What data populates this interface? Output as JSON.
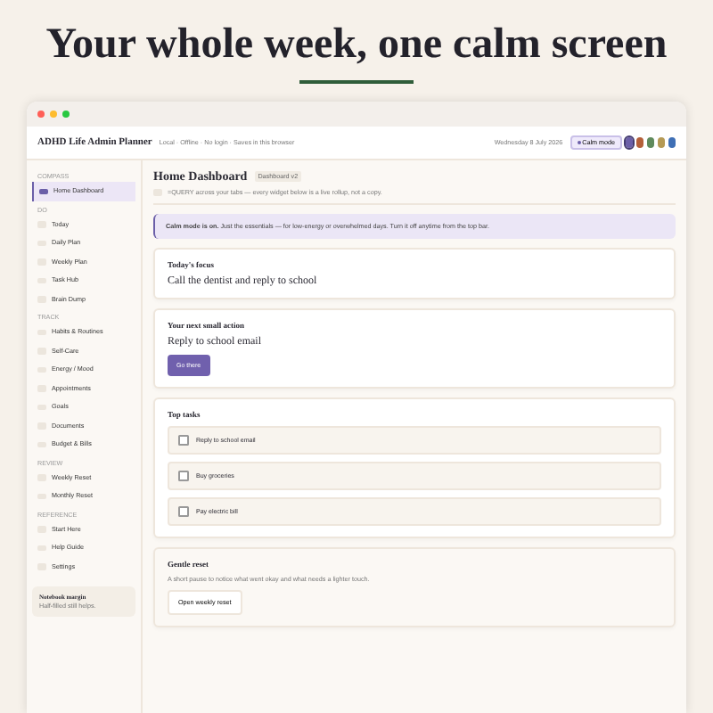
{
  "headline": "Your whole week, one calm screen",
  "window": {
    "title": "ADHD Life Admin Planner",
    "meta": "Local · Offline · No login · Saves in this browser",
    "date": "Wednesday 8 July 2026",
    "calm_button": {
      "label": "Calm mode",
      "on": true
    },
    "themes": [
      {
        "color": "#6b5fa8",
        "selected": true
      },
      {
        "color": "#b5603a",
        "selected": false
      },
      {
        "color": "#5f8a5c",
        "selected": false
      },
      {
        "color": "#b59a55",
        "selected": false
      },
      {
        "color": "#3f6fb5",
        "selected": false
      }
    ]
  },
  "sidebar": {
    "sections": [
      {
        "label": "COMPASS",
        "items": [
          {
            "label": "Home Dashboard",
            "selected": true
          }
        ]
      },
      {
        "label": "DO",
        "items": [
          {
            "label": "Today",
            "selected": false
          },
          {
            "label": "Daily Plan",
            "selected": false
          },
          {
            "label": "Weekly Plan",
            "selected": false
          },
          {
            "label": "Task Hub",
            "selected": false
          },
          {
            "label": "Brain Dump",
            "selected": false
          }
        ]
      },
      {
        "label": "TRACK",
        "items": [
          {
            "label": "Habits & Routines",
            "selected": false
          },
          {
            "label": "Self-Care",
            "selected": false
          },
          {
            "label": "Energy / Mood",
            "selected": false
          },
          {
            "label": "Appointments",
            "selected": false
          },
          {
            "label": "Goals",
            "selected": false
          },
          {
            "label": "Documents",
            "selected": false
          },
          {
            "label": "Budget & Bills",
            "selected": false
          }
        ]
      },
      {
        "label": "REVIEW",
        "items": [
          {
            "label": "Weekly Reset",
            "selected": false
          },
          {
            "label": "Monthly Reset",
            "selected": false
          }
        ]
      },
      {
        "label": "REFERENCE",
        "items": [
          {
            "label": "Start Here",
            "selected": false
          },
          {
            "label": "Help Guide",
            "selected": false
          },
          {
            "label": "Settings",
            "selected": false
          }
        ]
      }
    ],
    "note": {
      "title": "Notebook margin",
      "text": "Half-filled still helps."
    }
  },
  "main": {
    "title": "Home Dashboard",
    "badge": "Dashboard v2",
    "subtitle": "=QUERY across your tabs — every widget below is a live rollup, not a copy.",
    "banner": "**Calm mode is on.** Just the essentials — for low-energy or overwhelmed days. Turn it off anytime from the top bar.",
    "focus": {
      "title": "Today's focus",
      "text": "Call the dentist and reply to school"
    },
    "next_action": {
      "title": "Your next small action",
      "text": "Reply to school email",
      "button": "Go there"
    },
    "top_tasks": {
      "title": "Top tasks",
      "items": [
        {
          "label": "Reply to school email",
          "checked": false
        },
        {
          "label": "Buy groceries",
          "checked": false
        },
        {
          "label": "Pay electric bill",
          "checked": false
        }
      ]
    },
    "reset": {
      "title": "Gentle reset",
      "text": "A short pause to notice what went okay and what needs a lighter touch.",
      "button": "Open weekly reset"
    }
  }
}
